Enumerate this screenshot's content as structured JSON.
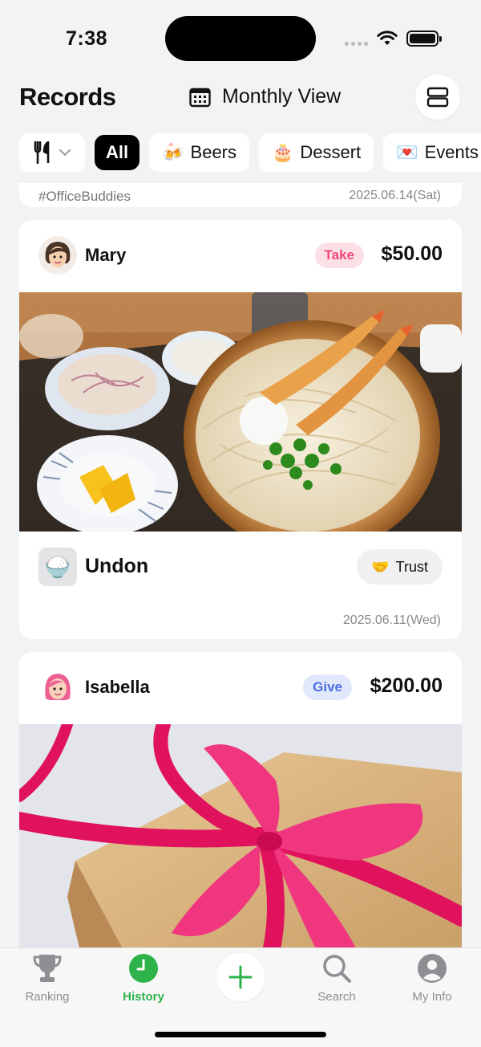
{
  "status_bar": {
    "time": "7:38"
  },
  "header": {
    "title": "Records",
    "view_label": "Monthly View"
  },
  "filters": {
    "category_icon": "fork-knife-icon",
    "chips": [
      {
        "label": "All",
        "emoji": ""
      },
      {
        "label": "Beers",
        "emoji": "🍻"
      },
      {
        "label": "Dessert",
        "emoji": "🎂"
      },
      {
        "label": "Events",
        "emoji": "💌"
      }
    ]
  },
  "records": [
    {
      "tag": "#OfficeBuddies",
      "date": "2025.06.14(Sat)"
    },
    {
      "person": "Mary",
      "type": "Take",
      "amount": "$50.00",
      "photo": "udon-bowl-with-tempura",
      "item": "Undon",
      "item_emoji": "🍚",
      "trust_label": "Trust",
      "trust_emoji": "🤝",
      "date": "2025.06.11(Wed)"
    },
    {
      "person": "Isabella",
      "type": "Give",
      "amount": "$200.00",
      "photo": "gift-box-with-pink-ribbon"
    }
  ],
  "tabbar": {
    "tabs": [
      {
        "label": "Ranking",
        "icon": "trophy-icon"
      },
      {
        "label": "History",
        "icon": "clock-icon"
      },
      {
        "label": "",
        "icon": "plus-icon"
      },
      {
        "label": "Search",
        "icon": "search-icon"
      },
      {
        "label": "My Info",
        "icon": "person-icon"
      }
    ]
  },
  "colors": {
    "accent_green": "#2db34a",
    "take_pink": "#f04a78",
    "give_blue": "#4a6ee0"
  }
}
